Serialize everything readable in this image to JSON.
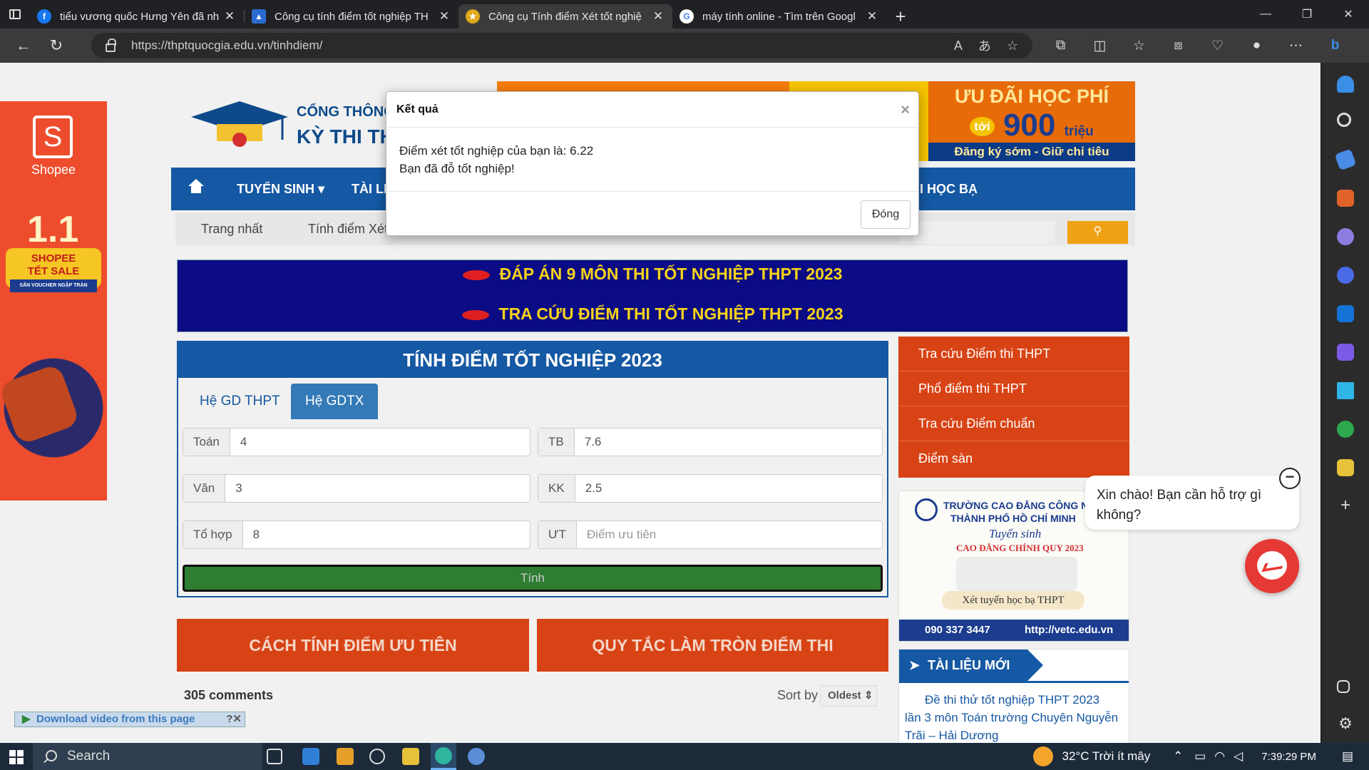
{
  "browser": {
    "tabs": [
      {
        "title": "tiểu vương quốc Hưng Yên đã nh",
        "favicon": "facebook-icon",
        "active": false
      },
      {
        "title": "Công cụ tính điểm tốt nghiệp TH",
        "favicon": "graduation-icon",
        "active": false
      },
      {
        "title": "Công cụ Tính điểm Xét tốt nghiệ",
        "favicon": "emblem-icon",
        "active": true
      },
      {
        "title": "máy tính online - Tìm trên Googl",
        "favicon": "google-icon",
        "active": false
      }
    ],
    "url": "https://thptquocgia.edu.vn/tinhdiem/"
  },
  "header": {
    "logo_line1": "CỔNG THÔNG T",
    "logo_line2": "KỲ THI THP",
    "promo_title": "ƯU ĐÃI HỌC PHÍ",
    "promo_toi": "tới",
    "promo_amount": "900",
    "promo_unit": "triệu",
    "promo_footer": "Đăng ký sớm - Giữ chỉ tiêu"
  },
  "shopee": {
    "brand": "Shopee",
    "big": "1.1",
    "badge_line1": "SHOPEE",
    "badge_line2": "TẾT SALE",
    "badge_line3": "SĂN VOUCHER NGẬP TRÀN"
  },
  "nav": {
    "tuyensinh": "TUYỂN SINH ▾",
    "tailieu": "TÀI LI",
    "hocba": "I HỌC BẠ"
  },
  "breadcrumb": {
    "home": "Trang nhất",
    "current": "Tính điểm Xét"
  },
  "banner": {
    "line1": "ĐÁP ÁN 9 MÔN THI TỐT NGHIỆP THPT 2023",
    "line2": "TRA CỨU ĐIỂM THI TỐT NGHIỆP THPT 2023"
  },
  "calc": {
    "title": "TÍNH ĐIỂM TỐT NGHIỆP 2023",
    "tab_thpt": "Hệ GD THPT",
    "tab_gdtx": "Hệ GDTX",
    "toan_label": "Toán",
    "toan_value": "4",
    "van_label": "Văn",
    "van_value": "3",
    "tohop_label": "Tổ hợp",
    "tohop_value": "8",
    "tb_label": "TB",
    "tb_value": "7.6",
    "kk_label": "KK",
    "kk_value": "2.5",
    "ut_label": "ƯT",
    "ut_placeholder": "Điểm ưu tiên",
    "submit": "Tính"
  },
  "sidebar_links": [
    "Tra cứu Điểm thi THPT",
    "Phổ điểm thi THPT",
    "Tra cứu Điểm chuẩn",
    "Điểm sàn"
  ],
  "ad_vetc": {
    "line1": "TRƯỜNG CAO ĐẲNG CÔNG NGHỆ",
    "line2": "THÀNH PHỐ HỒ CHÍ MINH",
    "line3": "Tuyển sinh",
    "line4": "CAO ĐẲNG CHÍNH QUY 2023",
    "line5": "Xét tuyển học bạ THPT",
    "phone": "090 337 3447",
    "site": "http://vetc.edu.vn"
  },
  "buttons": {
    "uutien": "CÁCH TÍNH ĐIỂM ƯU TIÊN",
    "lamtron": "QUY TẮC LÀM TRÒN ĐIỂM THI"
  },
  "tailieu": {
    "title": "TÀI LIỆU MỚI",
    "doc": "Đề thi thử tốt nghiệp THPT 2023 lần 3 môn Toán trường Chuyên Nguyễn Trãi – Hải Dương"
  },
  "comments": {
    "count": "305 comments",
    "sort_label": "Sort by",
    "sort_value": "Oldest ⇕"
  },
  "download_bar": "Download video from this page",
  "chat": {
    "message": "Xin chào! Bạn cần hỗ trợ gì không?"
  },
  "modal": {
    "title": "Kết quả",
    "line1": "Điểm xét tốt nghiệp của bạn là: 6.22",
    "line2": "Bạn đã đỗ tốt nghiệp!",
    "close_button": "Đóng"
  },
  "taskbar": {
    "search": "Search",
    "weather": "32°C  Trời ít mây",
    "time": "7:39:29 PM"
  },
  "colors": {
    "nav_blue": "#1558a3",
    "side_red": "#d84315",
    "banner_navy": "#0b0b85",
    "submit_green": "#2e7d32"
  }
}
